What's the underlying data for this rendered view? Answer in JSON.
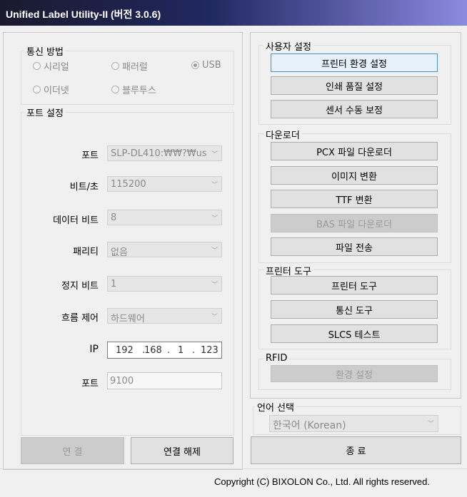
{
  "window": {
    "title": "Unified Label Utility-II (버전 3.0.6)"
  },
  "comm_method": {
    "label": "통신 방법",
    "options": [
      {
        "label": "시리얼",
        "selected": false
      },
      {
        "label": "패러럴",
        "selected": false
      },
      {
        "label": "USB",
        "selected": true
      },
      {
        "label": "이더넷",
        "selected": false
      },
      {
        "label": "블루투스",
        "selected": false
      }
    ]
  },
  "port_settings": {
    "label": "포트 설정",
    "port_label": "포트",
    "port_value": "SLP-DL410:₩₩?₩us",
    "baud_label": "비트/초",
    "baud_value": "115200",
    "databits_label": "데이터 비트",
    "databits_value": "8",
    "parity_label": "패리티",
    "parity_value": "없음",
    "stopbits_label": "정지 비트",
    "stopbits_value": "1",
    "flow_label": "흐름 제어",
    "flow_value": "하드웨어",
    "ip_label": "IP",
    "ip_octets": [
      "192",
      "168",
      "1",
      "123"
    ],
    "tcp_port_label": "포트",
    "tcp_port_value": "9100"
  },
  "connection": {
    "connect": "연 결",
    "disconnect": "연결 해제"
  },
  "user_settings": {
    "label": "사용자 설정",
    "printer_env": "프린터 환경 설정",
    "print_quality": "인쇄 품질 설정",
    "sensor_calib": "센서 수동 보정"
  },
  "downloader": {
    "label": "다운로더",
    "pcx": "PCX 파일 다운로더",
    "image": "이미지 변환",
    "ttf": "TTF 변환",
    "bas": "BAS 파일 다운로더",
    "file_transfer": "파일 전송"
  },
  "printer_tools": {
    "label": "프린터 도구",
    "printer_tool": "프린터 도구",
    "comm_tool": "통신 도구",
    "slcs_test": "SLCS 테스트"
  },
  "rfid": {
    "label": "RFID",
    "env": "환경 설정"
  },
  "language": {
    "label": "언어 선택",
    "value": "한국어 (Korean)"
  },
  "exit": "종 료",
  "footer": "Copyright (C) BIXOLON Co., Ltd. All rights reserved.",
  "colors": {
    "title_gradient_start": "#1a1a2e",
    "title_gradient_end": "#8a8ae0",
    "focus_border": "#4a8cd6"
  }
}
